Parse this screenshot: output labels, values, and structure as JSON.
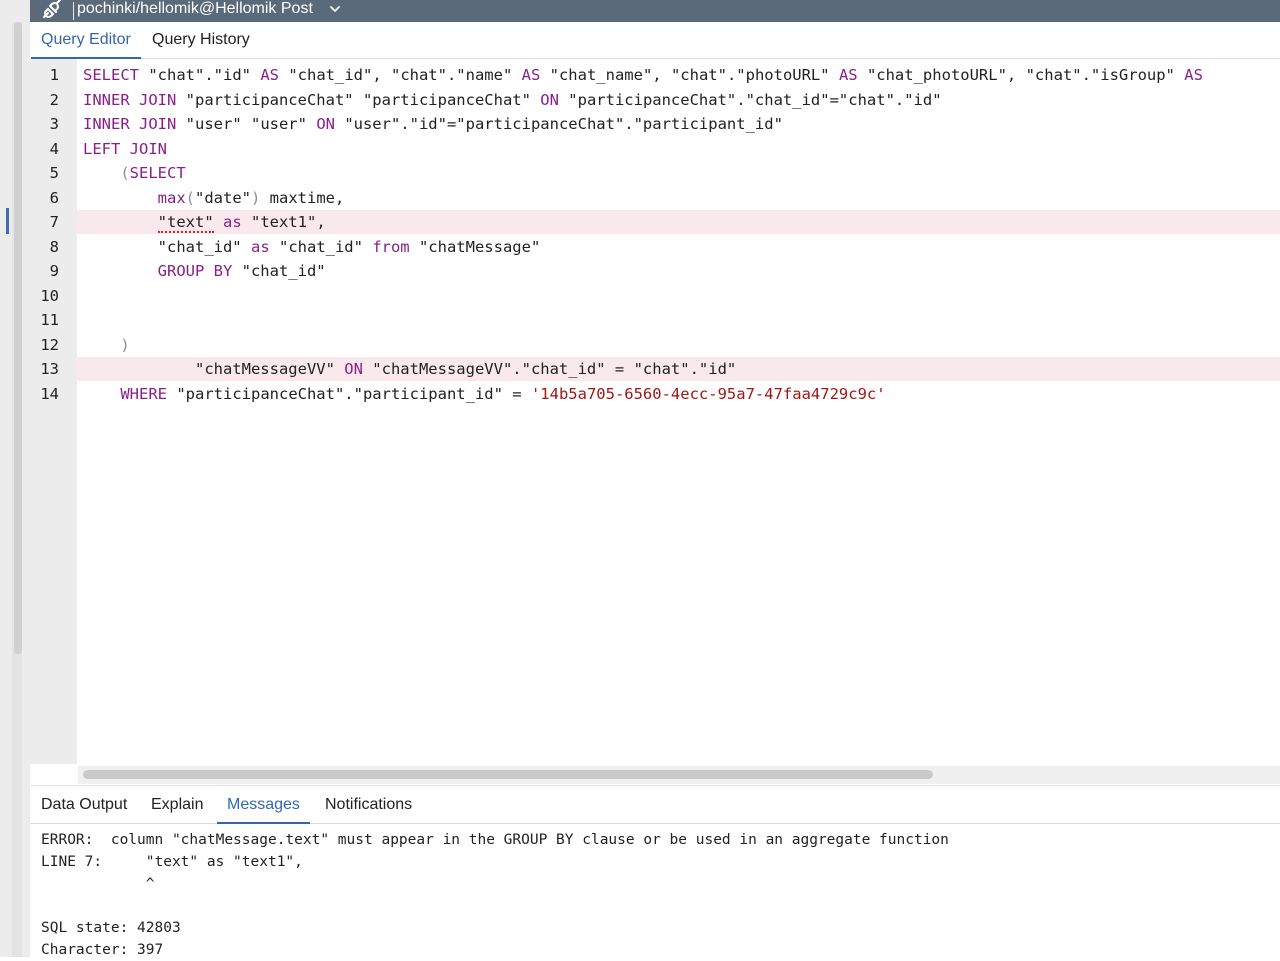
{
  "connection": {
    "label": "pochinki/hellomik@Hellomik Post"
  },
  "editor_tabs": [
    "Query Editor",
    "Query History"
  ],
  "editor": {
    "line_numbers": [
      "1",
      "2",
      "3",
      "4",
      "5",
      "6",
      "7",
      "8",
      "9",
      "10",
      "11",
      "12",
      "13",
      "14"
    ],
    "highlighted_lines": [
      7,
      13
    ],
    "lines": [
      [
        [
          "kw",
          "SELECT"
        ],
        [
          "p",
          " \"chat\".\"id\" "
        ],
        [
          "kw",
          "AS"
        ],
        [
          "p",
          " \"chat_id\", \"chat\".\"name\" "
        ],
        [
          "kw",
          "AS"
        ],
        [
          "p",
          " \"chat_name\", \"chat\".\"photoURL\" "
        ],
        [
          "kw",
          "AS"
        ],
        [
          "p",
          " \"chat_photoURL\", \"chat\".\"isGroup\" "
        ],
        [
          "kw",
          "AS"
        ]
      ],
      [
        [
          "kw",
          "INNER JOIN"
        ],
        [
          "p",
          " \"participanceChat\" \"participanceChat\" "
        ],
        [
          "kw",
          "ON"
        ],
        [
          "p",
          " \"participanceChat\".\"chat_id\"=\"chat\".\"id\""
        ]
      ],
      [
        [
          "kw",
          "INNER JOIN"
        ],
        [
          "p",
          " \"user\" \"user\" "
        ],
        [
          "kw",
          "ON"
        ],
        [
          "p",
          " \"user\".\"id\"=\"participanceChat\".\"participant_id\""
        ]
      ],
      [
        [
          "kw",
          "LEFT JOIN"
        ]
      ],
      [
        [
          "p",
          "    "
        ],
        [
          "paren",
          "("
        ],
        [
          "kw",
          "SELECT"
        ]
      ],
      [
        [
          "p",
          "        "
        ],
        [
          "kw",
          "max"
        ],
        [
          "paren",
          "("
        ],
        [
          "p",
          "\"date\""
        ],
        [
          "paren",
          ")"
        ],
        [
          "p",
          " maxtime,"
        ]
      ],
      [
        [
          "p",
          "        "
        ],
        [
          "sq",
          "\"text\""
        ],
        [
          "p",
          " "
        ],
        [
          "kw",
          "as"
        ],
        [
          "p",
          " \"text1\","
        ]
      ],
      [
        [
          "p",
          "        \"chat_id\" "
        ],
        [
          "kw",
          "as"
        ],
        [
          "p",
          " \"chat_id\" "
        ],
        [
          "kw",
          "from"
        ],
        [
          "p",
          " \"chatMessage\""
        ]
      ],
      [
        [
          "p",
          "        "
        ],
        [
          "kw",
          "GROUP BY"
        ],
        [
          "p",
          " \"chat_id\""
        ]
      ],
      [
        [
          "p",
          ""
        ]
      ],
      [
        [
          "p",
          ""
        ]
      ],
      [
        [
          "p",
          "    "
        ],
        [
          "paren",
          ")"
        ]
      ],
      [
        [
          "p",
          "            \"chatMessageVV\" "
        ],
        [
          "kw",
          "ON"
        ],
        [
          "p",
          " \"chatMessageVV\".\"chat_id\" = \"chat\".\"id\""
        ]
      ],
      [
        [
          "p",
          "    "
        ],
        [
          "kw",
          "WHERE"
        ],
        [
          "p",
          " \"participanceChat\".\"participant_id\" = "
        ],
        [
          "str",
          "'14b5a705-6560-4ecc-95a7-47faa4729c9c'"
        ]
      ]
    ]
  },
  "output_tabs": [
    "Data Output",
    "Explain",
    "Messages",
    "Notifications"
  ],
  "messages": {
    "lines": [
      "ERROR:  column \"chatMessage.text\" must appear in the GROUP BY clause or be used in an aggregate function",
      "LINE 7:     \"text\" as \"text1\",",
      "            ^",
      "",
      "SQL state: 42803",
      "Character: 397"
    ]
  },
  "colors": {
    "topbar": "#5b6a7b",
    "active_tab": "#3367b0",
    "keyword": "#8a1f8a",
    "string": "#a31515",
    "line_highlight": "#f9e9ec"
  }
}
